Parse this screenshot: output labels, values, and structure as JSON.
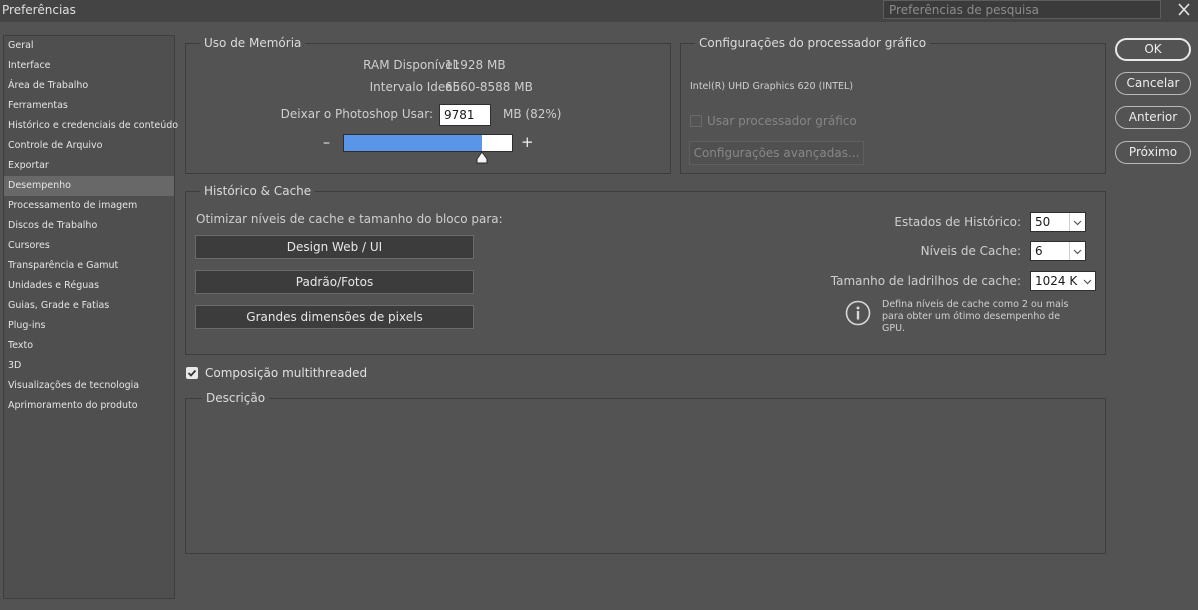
{
  "window": {
    "title": "Preferências",
    "search_placeholder": "Preferências de pesquisa"
  },
  "sidebar": {
    "items": [
      {
        "label": "Geral"
      },
      {
        "label": "Interface"
      },
      {
        "label": "Área de Trabalho"
      },
      {
        "label": "Ferramentas"
      },
      {
        "label": "Histórico e credenciais de conteúdo"
      },
      {
        "label": "Controle de Arquivo"
      },
      {
        "label": "Exportar"
      },
      {
        "label": "Desempenho",
        "selected": true
      },
      {
        "label": "Processamento de imagem"
      },
      {
        "label": "Discos de Trabalho"
      },
      {
        "label": "Cursores"
      },
      {
        "label": "Transparência e Gamut"
      },
      {
        "label": "Unidades e Réguas"
      },
      {
        "label": "Guias, Grade e Fatias"
      },
      {
        "label": "Plug-ins"
      },
      {
        "label": "Texto"
      },
      {
        "label": "3D"
      },
      {
        "label": "Visualizações de tecnologia"
      },
      {
        "label": "Aprimoramento do produto"
      }
    ]
  },
  "memory": {
    "title": "Uso de Memória",
    "ram_label": "RAM Disponível:",
    "ram_value": "11928 MB",
    "ideal_label": "Intervalo Ideal:",
    "ideal_value": "6560-8588 MB",
    "let_use_label": "Deixar o Photoshop Usar:",
    "let_use_value": "9781",
    "let_use_suffix": "MB (82%)",
    "slider_fraction": 0.82,
    "minus": "–",
    "plus": "+"
  },
  "gpu": {
    "title": "Configurações do processador gráfico",
    "device": "Intel(R) UHD Graphics 620 (INTEL)",
    "use_gpu_label": "Usar processador gráfico",
    "use_gpu_checked": false,
    "advanced_button": "Configurações avançadas..."
  },
  "cache": {
    "title": "Histórico & Cache",
    "optimize_label": "Otimizar níveis de cache e tamanho do bloco para:",
    "buttons": [
      "Design Web / UI",
      "Padrão/Fotos",
      "Grandes dimensões de pixels"
    ],
    "history_states_label": "Estados de Histórico:",
    "history_states_value": "50",
    "cache_levels_label": "Níveis de Cache:",
    "cache_levels_value": "6",
    "tile_size_label": "Tamanho de ladrilhos de cache:",
    "tile_size_value": "1024 K",
    "info_lines": [
      "Defina níveis de cache como 2 ou mais",
      "para obter um ótimo desempenho de",
      "GPU."
    ]
  },
  "multithreaded": {
    "label": "Composição multithreaded",
    "checked": true
  },
  "description": {
    "title": "Descrição"
  },
  "actions": {
    "ok": "OK",
    "cancel": "Cancelar",
    "prev": "Anterior",
    "next": "Próximo"
  },
  "colors": {
    "accent_slider": "#5b95e8",
    "panel_bg": "#535353",
    "selected_item": "#686868"
  }
}
